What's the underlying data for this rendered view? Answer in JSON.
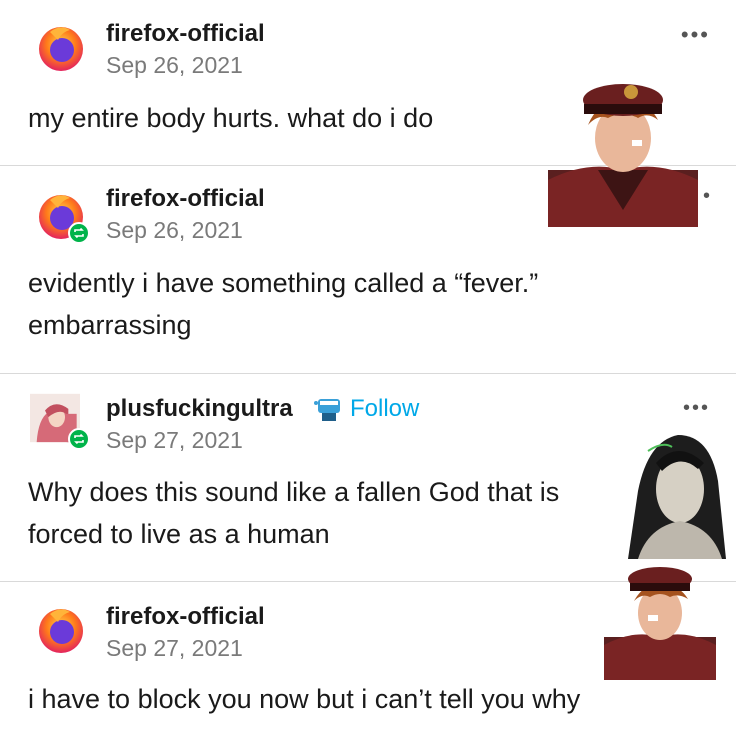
{
  "posts": [
    {
      "username": "firefox-official",
      "date": "Sep 26, 2021",
      "text": "my entire body hurts. what do i do",
      "avatar": "firefox-logo",
      "reblog": false
    },
    {
      "username": "firefox-official",
      "date": "Sep 26, 2021",
      "text": "evidently i have something called a “fever.” embarrassing",
      "avatar": "firefox-logo",
      "reblog": true
    },
    {
      "username": "plusfuckingultra",
      "date": "Sep 27, 2021",
      "text": "Why does this sound like a fallen God that is forced to live as a human",
      "avatar": "anime-character",
      "reblog": true,
      "follow_label": "Follow"
    },
    {
      "username": "firefox-official",
      "date": "Sep 27, 2021",
      "text": "i have to block you now but i can’t tell you why",
      "avatar": "firefox-logo",
      "reblog": false
    }
  ],
  "more_menu_label": "•••",
  "colors": {
    "follow": "#00a8e8",
    "reblog_badge": "#00b34a",
    "date": "#7a7a7a",
    "divider": "#d9d9d9"
  }
}
